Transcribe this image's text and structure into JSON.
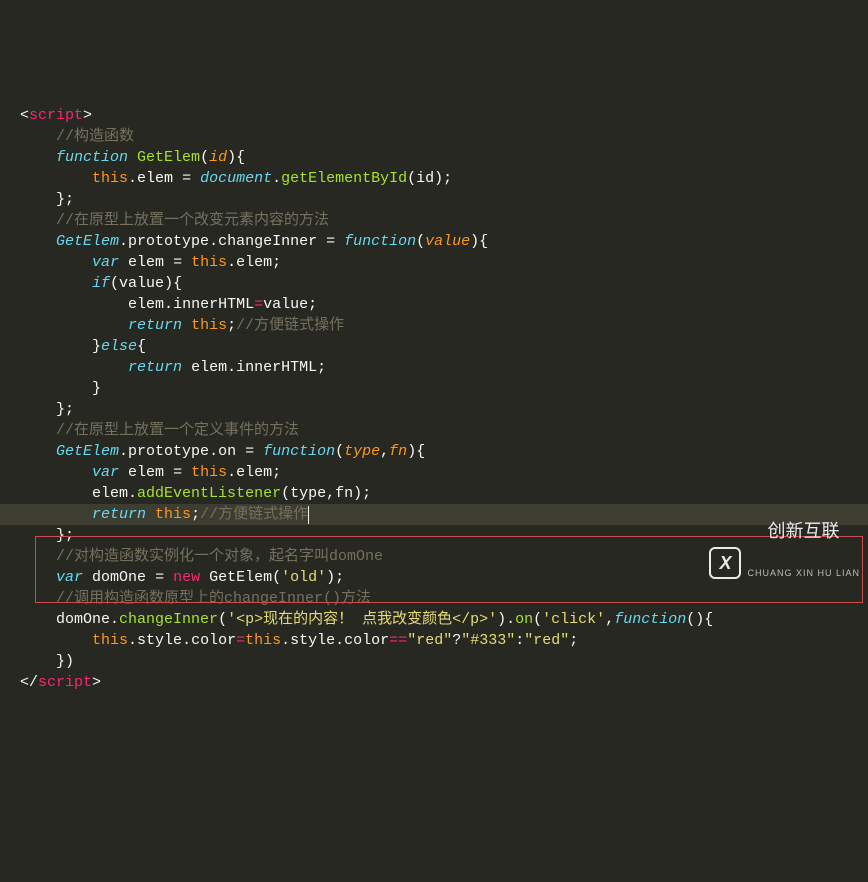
{
  "tag_open_angle": "<",
  "tag_close_angle": ">",
  "tag_slash": "</",
  "tag_name": "script",
  "c1": "//构造函数",
  "kw_function": "function",
  "fn_GetElem": "GetElem",
  "p_id": "id",
  "this": "this",
  "dot": ".",
  "prop_elem": "elem",
  "eq": " = ",
  "eq2": " = ",
  "ident_document": "document",
  "m_getElementById": "getElementById",
  "c2": "//在原型上放置一个改变元素内容的方法",
  "ident_GetElem": "GetElem",
  "prop_prototype": "prototype",
  "m_changeInner": "changeInner",
  "p_value": "value",
  "kw_var": "var",
  "ident_elem": "elem",
  "kw_if": "if",
  "ident_value": "value",
  "prop_innerHTML": "innerHTML",
  "kw_return": "return",
  "c3": "//方便链式操作",
  "kw_else": "else",
  "c4": "//在原型上放置一个定义事件的方法",
  "m_on": "on",
  "p_type": "type",
  "p_fn": "fn",
  "m_addEventListener": "addEventListener",
  "ident_type": "type",
  "ident_fn": "fn",
  "c5": "//方便链式操作",
  "c6": "//对构造函数实例化一个对象，起名字叫domOne",
  "ident_domOne": "domOne",
  "kw_new": "new",
  "str_old": "'old'",
  "c7": "//调用构造函数原型上的changeInner()方法",
  "str_html": "'<p>现在的内容！ 点我改变颜色</p>'",
  "str_click": "'click'",
  "prop_style": "style",
  "prop_color": "color",
  "str_red": "\"red\"",
  "str_333": "\"#333\"",
  "str_red2": "\"red\"",
  "watermark_cn": "创新互联",
  "watermark_en": "CHUANG XIN HU LIAN"
}
